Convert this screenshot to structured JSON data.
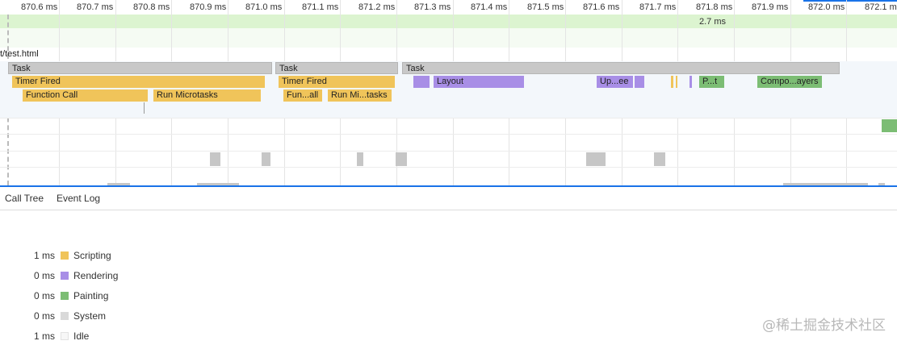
{
  "ruler": {
    "ticks": [
      "870.6 ms",
      "870.7 ms",
      "870.8 ms",
      "870.9 ms",
      "871.0 ms",
      "871.1 ms",
      "871.2 ms",
      "871.3 ms",
      "871.4 ms",
      "871.5 ms",
      "871.6 ms",
      "871.7 ms",
      "871.8 ms",
      "871.9 ms",
      "872.0 ms",
      "872.1 ms"
    ]
  },
  "selection_duration": "2.7 ms",
  "track_title": "t/test.html",
  "flame": {
    "tasks": [
      "Task",
      "Task",
      "Task"
    ],
    "timer_fired": [
      "Timer Fired",
      "Timer Fired"
    ],
    "function_call": [
      "Function Call",
      "Fun...all"
    ],
    "run_microtasks": [
      "Run Microtasks",
      "Run Mi...tasks"
    ],
    "layout": "Layout",
    "update": "Up...ee",
    "paint": "P...t",
    "composite": "Compo...ayers"
  },
  "tabs": [
    "Call Tree",
    "Event Log"
  ],
  "summary": [
    {
      "value": "1 ms",
      "label": "Scripting",
      "color": "#f0c45a"
    },
    {
      "value": "0 ms",
      "label": "Rendering",
      "color": "#a88ee6"
    },
    {
      "value": "0 ms",
      "label": "Painting",
      "color": "#7cbd74"
    },
    {
      "value": "0 ms",
      "label": "System",
      "color": "#d9d9d9"
    },
    {
      "value": "1 ms",
      "label": "Idle",
      "color": "#f7f7f7"
    }
  ],
  "watermark": "@稀土掘金技术社区"
}
